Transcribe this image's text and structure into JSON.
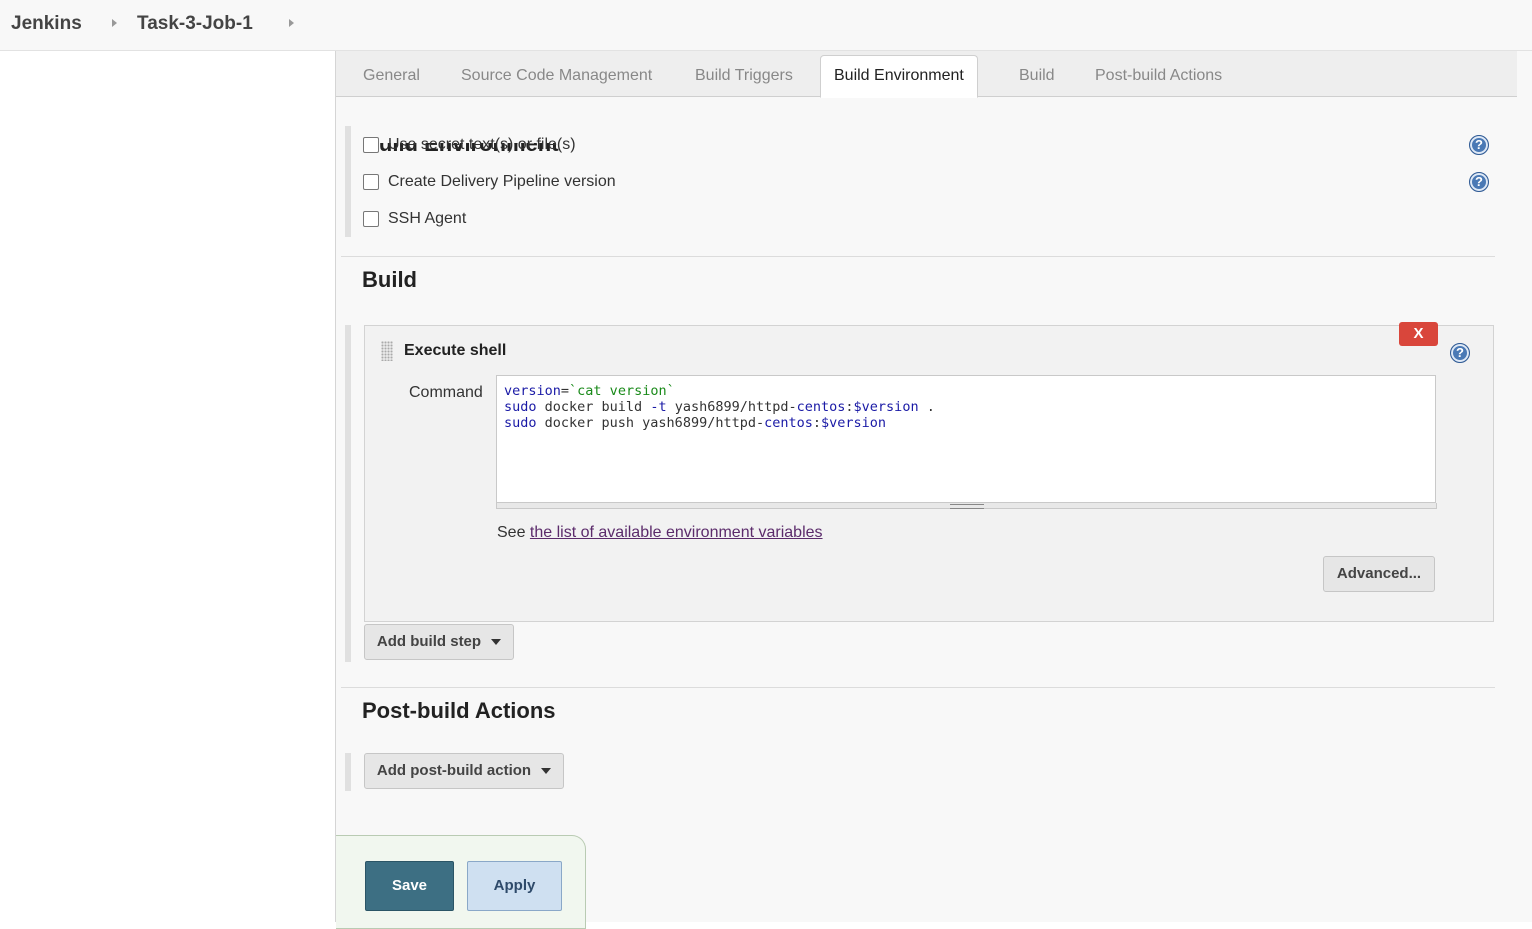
{
  "breadcrumb": {
    "home": "Jenkins",
    "job": "Task-3-Job-1"
  },
  "tabs": [
    {
      "label": "General"
    },
    {
      "label": "Source Code Management"
    },
    {
      "label": "Build Triggers"
    },
    {
      "label": "Build Environment",
      "active": true
    },
    {
      "label": "Build"
    },
    {
      "label": "Post-build Actions"
    }
  ],
  "build_environment": {
    "heading": "Build Environment",
    "options": [
      {
        "label": "Use secret text(s) or file(s)",
        "checked": false
      },
      {
        "label": "Create Delivery Pipeline version",
        "checked": false
      },
      {
        "label": "SSH Agent",
        "checked": false
      }
    ],
    "help_icon": "?"
  },
  "build": {
    "heading": "Build",
    "step": {
      "title": "Execute shell",
      "delete_label": "X",
      "command_label": "Command",
      "command_lines": [
        "version=`cat version`",
        "sudo docker build -t yash6899/httpd-centos:$version .",
        "sudo docker push yash6899/httpd-centos:$version"
      ],
      "see_prefix": "See ",
      "see_link": "the list of available environment variables",
      "advanced_label": "Advanced..."
    },
    "add_step_label": "Add build step"
  },
  "post_build": {
    "heading": "Post-build Actions",
    "add_action_label": "Add post-build action"
  },
  "footer": {
    "save_label": "Save",
    "apply_label": "Apply"
  },
  "colors": {
    "save": "#3d6f83",
    "apply": "#cfe0f1",
    "delete": "#d9463b",
    "help": "#4a79b5"
  }
}
